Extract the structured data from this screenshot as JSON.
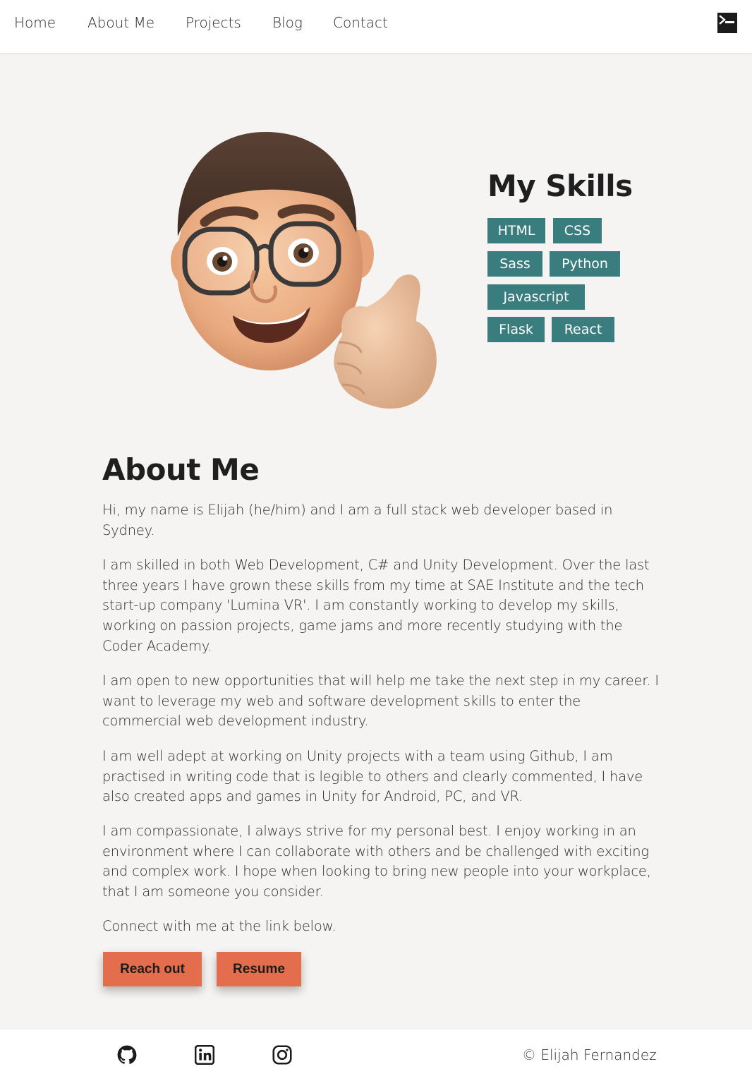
{
  "nav": {
    "items": [
      {
        "label": "Home"
      },
      {
        "label": "About Me"
      },
      {
        "label": "Projects"
      },
      {
        "label": "Blog"
      },
      {
        "label": "Contact"
      }
    ],
    "theme_icon": "terminal-icon"
  },
  "hero": {
    "avatar_icon": "memoji-thumbs-up-avatar",
    "skills_title": "My Skills",
    "skills": [
      "HTML",
      "CSS",
      "Sass",
      "Python",
      "Javascript",
      "Flask",
      "React"
    ]
  },
  "about": {
    "title": "About Me",
    "paragraphs": [
      "Hi, my name is Elijah (he/him) and I am a full stack web developer based in Sydney.",
      "I am skilled in both Web Development, C# and Unity Development. Over the last three years I have grown these skills from my time at SAE Institute and the tech start-up company 'Lumina VR'. I am constantly working to develop my skills, working on passion projects, game jams and more recently studying with the Coder Academy.",
      "I am open to new opportunities that will help me take the next step in my career. I want to leverage my web and software development skills to enter the commercial web development industry.",
      "I am well adept at working on Unity projects with a team using Github, I am practised in writing code that is legible to others and clearly commented, I have also created apps and games in Unity for Android, PC, and VR.",
      "I am compassionate, I always strive for my personal best. I enjoy working in an environment where I can collaborate with others and be challenged with exciting and complex work. I hope when looking to bring new people into your workplace, that I am someone you consider.",
      "Connect with me at the link below."
    ],
    "buttons": {
      "reach_out": "Reach out",
      "resume": "Resume"
    }
  },
  "footer": {
    "social_icons": [
      "github-icon",
      "linkedin-icon",
      "instagram-icon"
    ],
    "copyright": "© Elijah Fernandez"
  },
  "colors": {
    "page_background": "#f5f4f2",
    "skill_tag": "#3a7d7e",
    "button_accent": "#e46d4e",
    "text": "#222222"
  }
}
